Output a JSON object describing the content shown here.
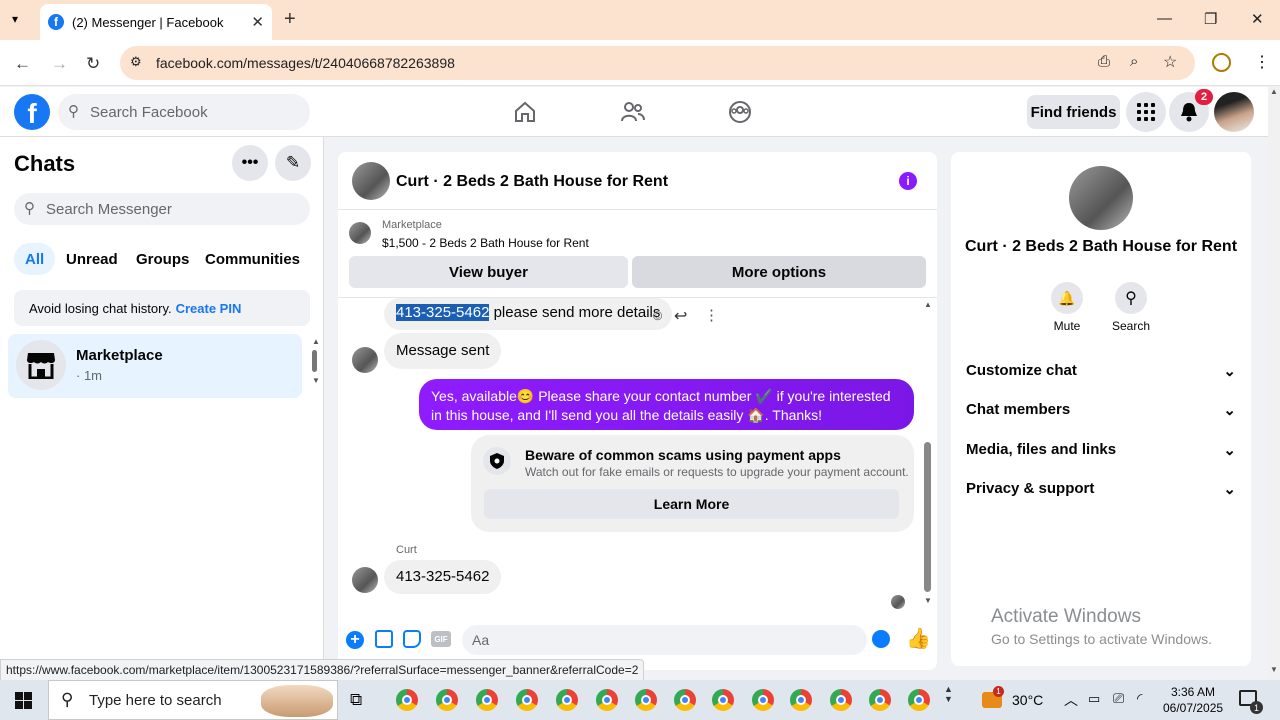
{
  "browser": {
    "tab_title": "(2) Messenger | Facebook",
    "url": "facebook.com/messages/t/24040668782263898",
    "status_url": "https://www.facebook.com/marketplace/item/1300523171589386/?referralSurface=messenger_banner&referralCode=2"
  },
  "header": {
    "search_placeholder": "Search Facebook",
    "find_friends": "Find friends",
    "notification_count": "2"
  },
  "chats": {
    "title": "Chats",
    "search_placeholder": "Search Messenger",
    "filters": [
      "All",
      "Unread",
      "Groups",
      "Communities"
    ],
    "pin_text": "Avoid losing chat history.",
    "pin_link": "Create PIN",
    "item_name": "Marketplace",
    "item_time": "· 1m"
  },
  "conversation": {
    "title": "Curt · 2 Beds 2 Bath House for Rent",
    "marketplace_label": "Marketplace",
    "listing": "$1,500 - 2 Beds 2 Bath House for Rent",
    "view_buyer": "View buyer",
    "more_options": "More options",
    "msg1_highlight": "413-325-5462",
    "msg1_rest": " please send more details",
    "msg2": "Message sent",
    "out_msg": "Yes, available😊 Please share your contact number ✔️ if you're interested in this house, and I'll send you all the details easily 🏠. Thanks!",
    "scam_title": "Beware of common scams using payment apps",
    "scam_sub": "Watch out for fake emails or requests to upgrade your payment account.",
    "learn_more": "Learn More",
    "sender_name": "Curt",
    "msg3": "413-325-5462",
    "composer_placeholder": "Aa"
  },
  "info": {
    "title": "Curt · 2 Beds 2 Bath House for Rent",
    "mute": "Mute",
    "search": "Search",
    "sections": [
      "Customize chat",
      "Chat members",
      "Media, files and links",
      "Privacy & support"
    ],
    "activate_title": "Activate Windows",
    "activate_sub": "Go to Settings to activate Windows."
  },
  "taskbar": {
    "search_placeholder": "Type here to search",
    "weather": "30°C",
    "weather_badge": "1",
    "time": "3:36 AM",
    "date": "06/07/2025",
    "notif": "1"
  }
}
